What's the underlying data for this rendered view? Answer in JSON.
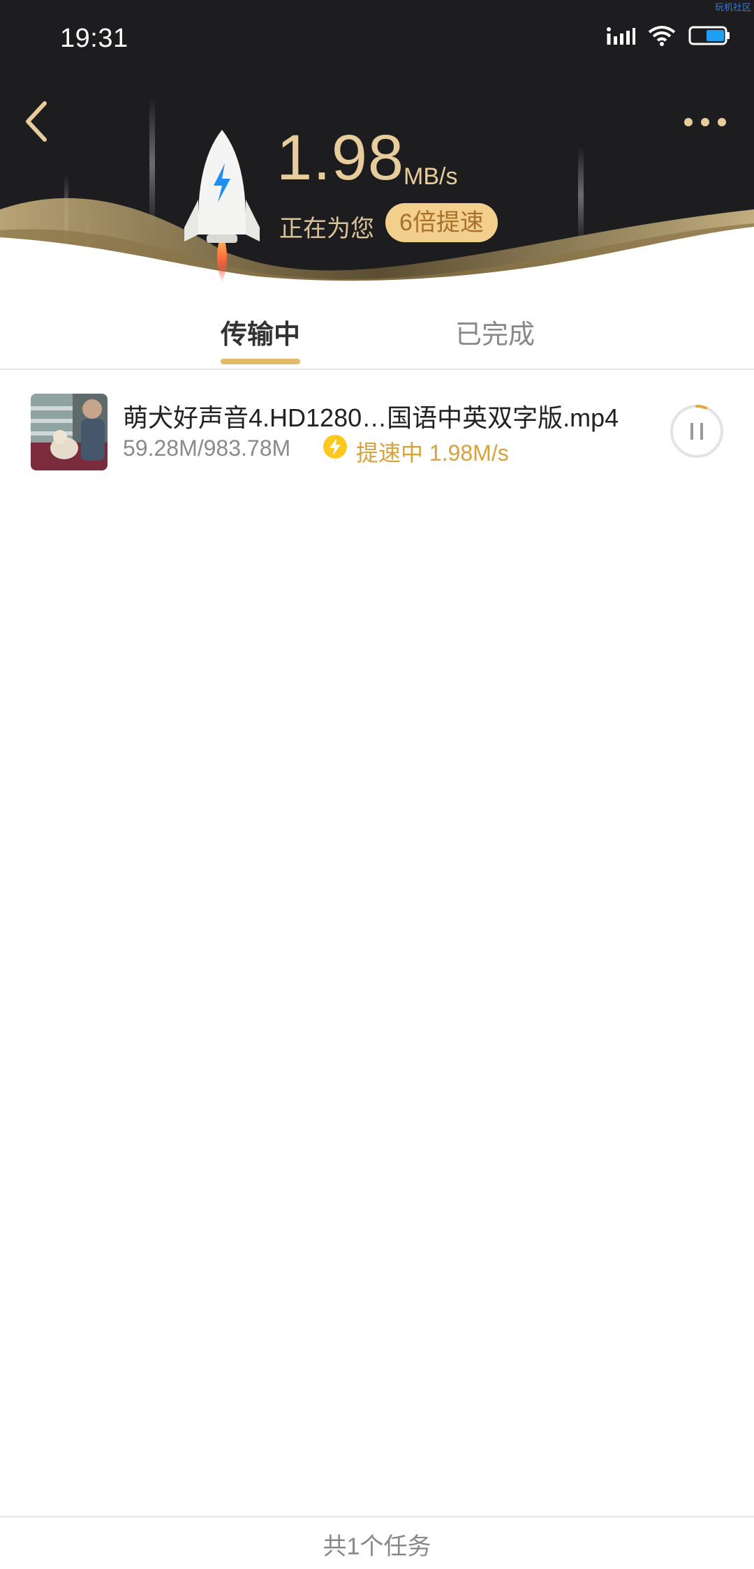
{
  "status_bar": {
    "time": "19:31",
    "watermark": "玩机社区"
  },
  "header": {
    "speed_value": "1.98",
    "speed_unit": "MB/s",
    "boost_text": "正在为您",
    "boost_badge": "6倍提速",
    "colors": {
      "bg": "#1d1d1f",
      "gold": "#e7cd9b",
      "badge": "#f2cf8d"
    }
  },
  "tabs": [
    {
      "label": "传输中",
      "active": true
    },
    {
      "label": "已完成",
      "active": false
    }
  ],
  "downloads": [
    {
      "name": "萌犬好声音4.HD1280…国语中英双字版.mp4",
      "size": "59.28M/983.78M",
      "status": "提速中 1.98M/s",
      "progress": 0.06
    }
  ],
  "footer": {
    "summary": "共1个任务"
  },
  "icons": [
    "back-arrow-icon",
    "more-dots-icon",
    "rocket-icon",
    "lightning-icon",
    "pause-icon",
    "signal-icon",
    "wifi-icon",
    "battery-icon"
  ]
}
